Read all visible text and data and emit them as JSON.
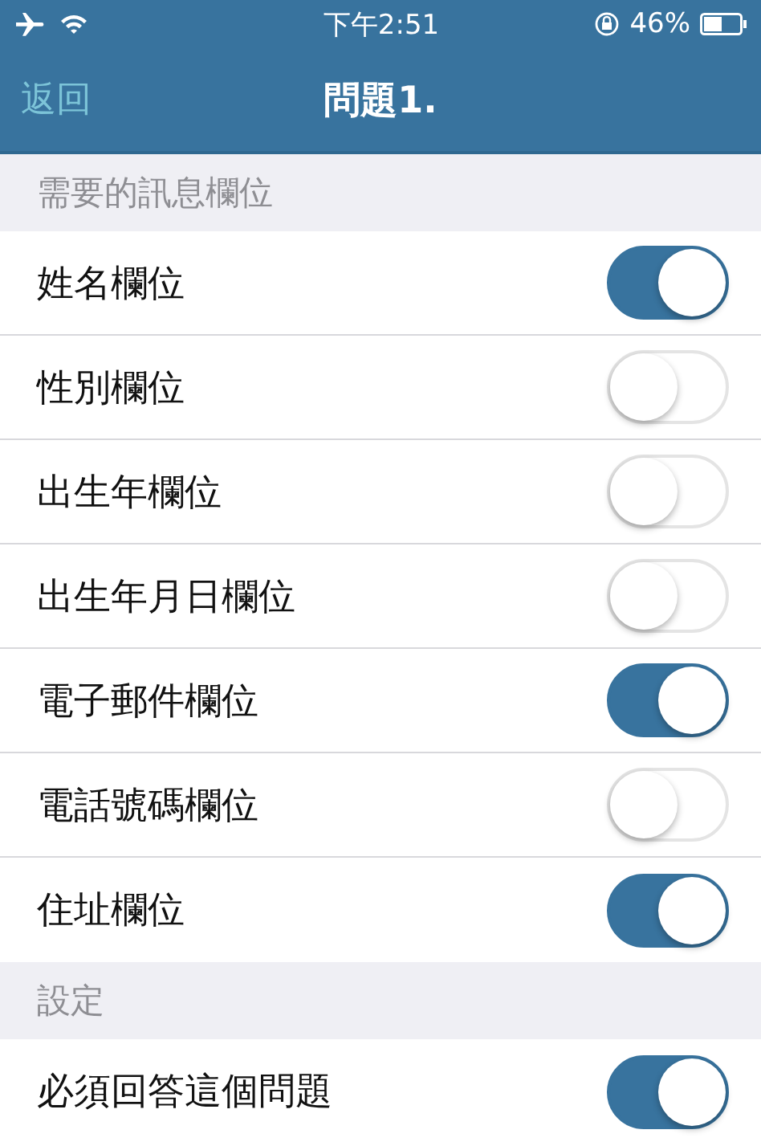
{
  "status_bar": {
    "time": "下午2:51",
    "battery": "46%"
  },
  "nav_bar": {
    "back": "返回",
    "title": "問題1."
  },
  "sections": [
    {
      "header": "需要的訊息欄位",
      "rows": [
        {
          "label": "姓名欄位",
          "on": true
        },
        {
          "label": "性別欄位",
          "on": false
        },
        {
          "label": "出生年欄位",
          "on": false
        },
        {
          "label": "出生年月日欄位",
          "on": false
        },
        {
          "label": "電子郵件欄位",
          "on": true
        },
        {
          "label": "電話號碼欄位",
          "on": false
        },
        {
          "label": "住址欄位",
          "on": true
        }
      ]
    },
    {
      "header": "設定",
      "rows": [
        {
          "label": "必須回答這個問題",
          "on": true
        }
      ]
    }
  ]
}
